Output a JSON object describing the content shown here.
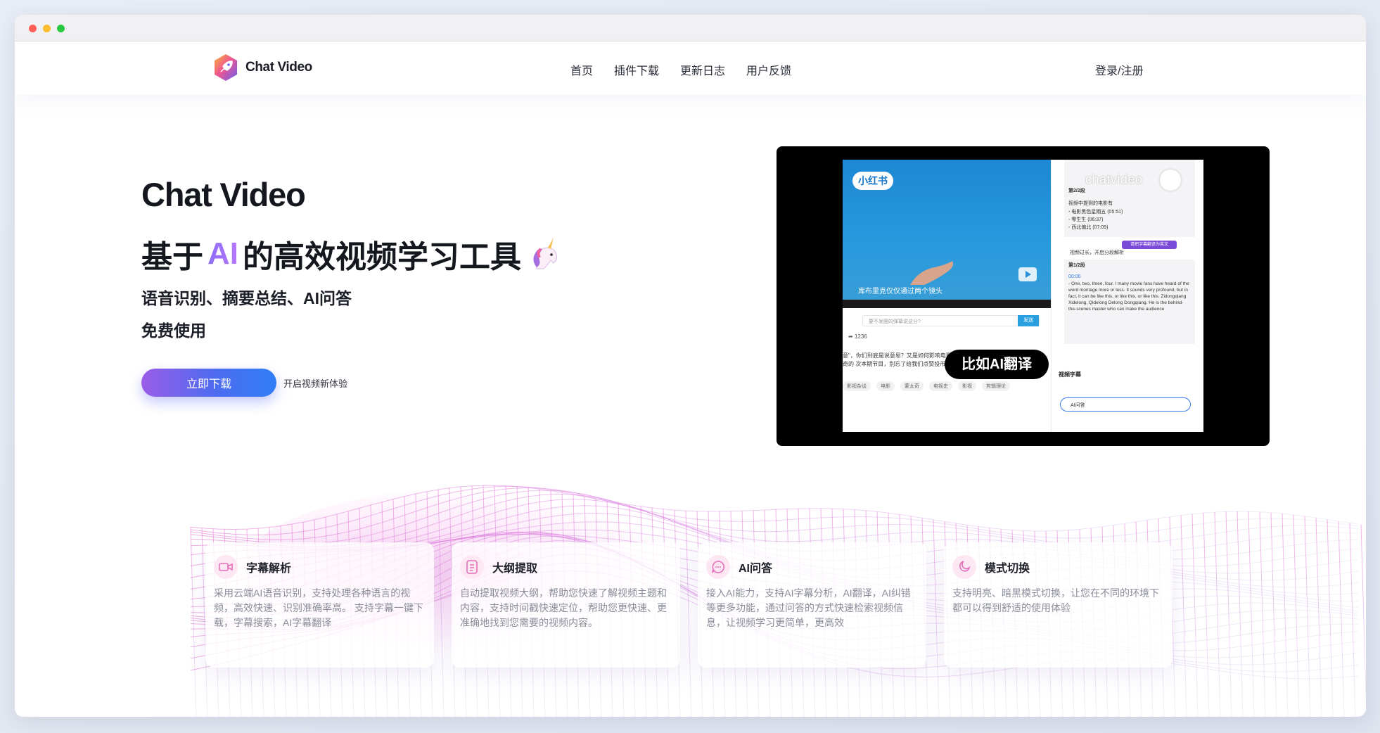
{
  "nav": {
    "brand": "Chat Video",
    "links": [
      "首页",
      "插件下载",
      "更新日志",
      "用户反馈"
    ],
    "login": "登录/注册"
  },
  "hero": {
    "title": "Chat Video",
    "subtitle_pre": "基于",
    "subtitle_ai": "AI",
    "subtitle_post": "的高效视频学习工具",
    "features": "语音识别、摘要总结、AI问答",
    "free": "免费使用",
    "cta_label": "立即下载",
    "cta_caption": "开启视频新体验"
  },
  "demo": {
    "platform_badge": "小红书",
    "video_caption": "库布里克仅仅通过两个镜头",
    "comment_placeholder": "要不发圈的弹幕说这分?",
    "send_label": "发送",
    "share_count": "1236",
    "comment_text": "意\"，你们到底是说意思？又是如何影响电影的发展的？这次让我们一起进入要太奇的\n次本期节目，别忘了给我们点赞投币，分享给更多的朋友~",
    "tags": [
      "影视杂谈",
      "电影",
      "蒙太奇",
      "电视史",
      "影视",
      "剪辑理论"
    ],
    "watermark": "chatvideo",
    "chat_heading": "第2/2段",
    "chat_outline_intro": "视频中提到的电影有",
    "chat_outline_items": [
      "- 电影黑色星期五 (05:51)",
      "- 零生生 (06:37)",
      "- 西北偏北 (07:09)"
    ],
    "chat_request": "请把字幕翻译为英文",
    "chat_reply_intro": "视频过长，开启分段解析",
    "chat_reply_heading": "第1/2段",
    "chat_reply_time": "00:00",
    "chat_reply_text": "- One, two, three, four. I many movie fans have heard of the word montage more or less. It sounds very profound, but in fact, it can be like this, or like this, or like this. Zidongqiang Xidelong, Qidelong Delong Dongqiang. He is the behind-the-scenes master who can make the audience",
    "subtitles_label": "视频字幕",
    "ai_input_label": "AI问答",
    "translate_pill": "比如AI翻译"
  },
  "cards": [
    {
      "icon": "video-camera-icon",
      "title": "字幕解析",
      "desc": "采用云端AI语音识别，支持处理各种语言的视频，高效快速、识别准确率高。 支持字幕一键下载，字幕搜索，AI字幕翻译"
    },
    {
      "icon": "outline-doc-icon",
      "title": "大纲提取",
      "desc": "自动提取视频大纲，帮助您快速了解视频主题和内容，支持时间戳快速定位，帮助您更快速、更准确地找到您需要的视频内容。"
    },
    {
      "icon": "chat-bubble-icon",
      "title": "AI问答",
      "desc": "接入AI能力，支持AI字幕分析，AI翻译，AI纠错等更多功能，通过问答的方式快速检索视频信息，让视频学习更简单，更高效"
    },
    {
      "icon": "moon-icon",
      "title": "模式切换",
      "desc": "支持明亮、暗黑模式切换，让您在不同的环境下都可以得到舒适的使用体验"
    }
  ],
  "colors": {
    "accent_purple": "#8b6cf6",
    "accent_blue": "#2f7ef6",
    "accent_pink": "#e46fd0",
    "card_icon_bg": "#fde7f2"
  }
}
